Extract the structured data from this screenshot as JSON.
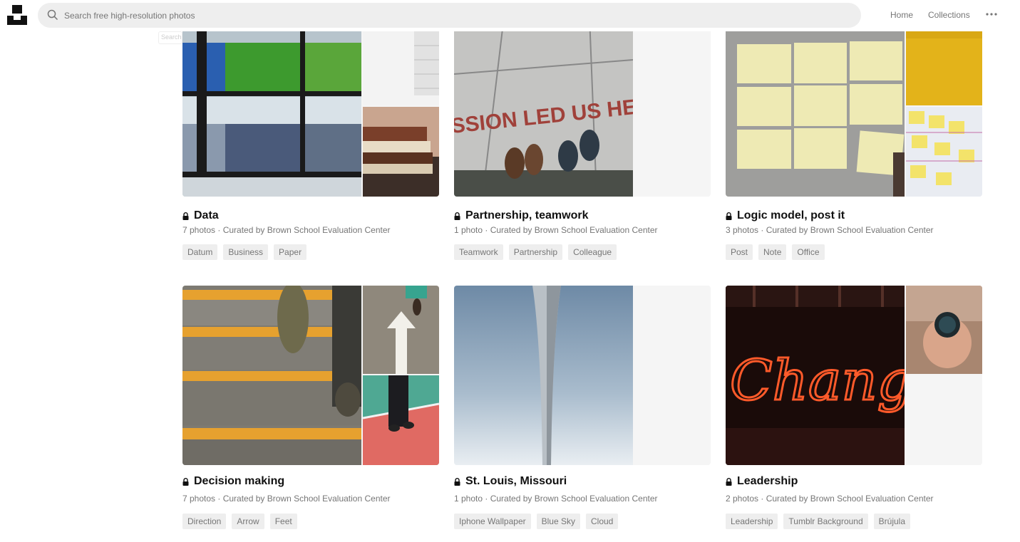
{
  "header": {
    "logo_icon": "unsplash-logo-icon",
    "search_icon": "search-icon",
    "search_placeholder": "Search free high-resolution photos",
    "nav": {
      "home": "Home",
      "collections": "Collections"
    },
    "more_icon": "ellipsis-icon"
  },
  "search_hint": "Search",
  "collections": [
    {
      "title": "Data",
      "meta": "7 photos · Curated by Brown School Evaluation Center",
      "tags": [
        "Datum",
        "Business",
        "Paper"
      ],
      "lock_icon": "lock-icon"
    },
    {
      "title": "Partnership, teamwork",
      "meta": "1 photo · Curated by Brown School Evaluation Center",
      "tags": [
        "Teamwork",
        "Partnership",
        "Colleague"
      ],
      "lock_icon": "lock-icon",
      "big_text": "SSION LED US HE"
    },
    {
      "title": "Logic model, post it",
      "meta": "3 photos · Curated by Brown School Evaluation Center",
      "tags": [
        "Post",
        "Note",
        "Office"
      ],
      "lock_icon": "lock-icon"
    },
    {
      "title": "Decision making",
      "meta": "7 photos · Curated by Brown School Evaluation Center",
      "tags": [
        "Direction",
        "Arrow",
        "Feet"
      ],
      "lock_icon": "lock-icon"
    },
    {
      "title": "St. Louis, Missouri",
      "meta": "1 photo · Curated by Brown School Evaluation Center",
      "tags": [
        "Iphone Wallpaper",
        "Blue Sky",
        "Cloud"
      ],
      "lock_icon": "lock-icon"
    },
    {
      "title": "Leadership",
      "meta": "2 photos · Curated by Brown School Evaluation Center",
      "tags": [
        "Leadership",
        "Tumblr Background",
        "Brújula"
      ],
      "lock_icon": "lock-icon",
      "big_text": "Chang"
    }
  ]
}
